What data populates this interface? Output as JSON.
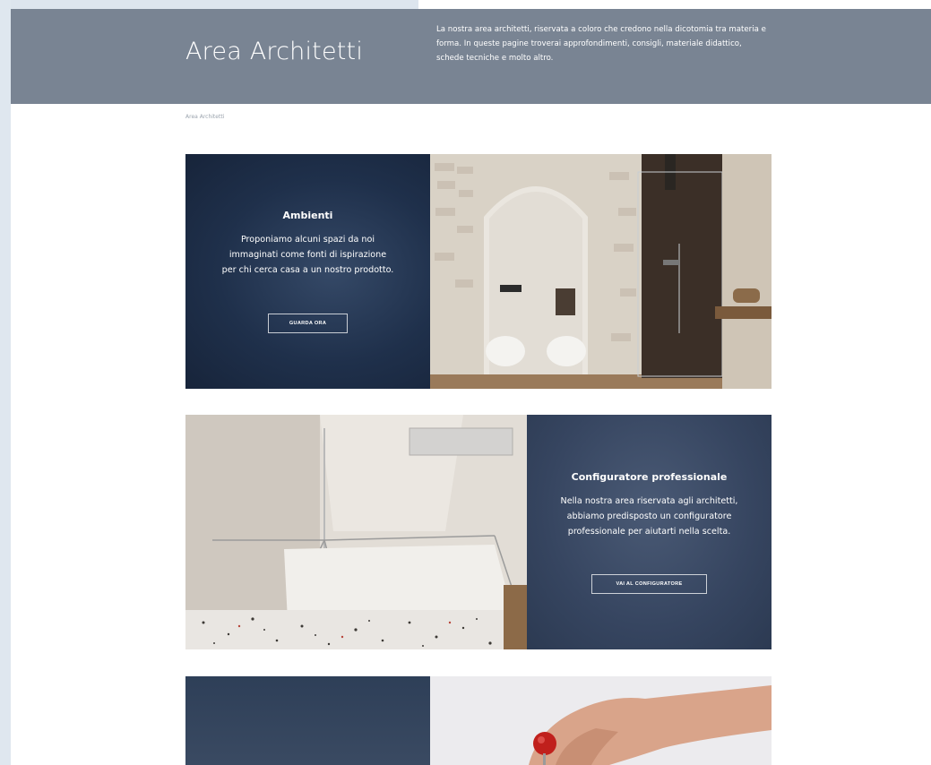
{
  "hero": {
    "title": "Area Architetti",
    "description": "La nostra area architetti, riservata a coloro che credono nella dicotomia tra materia e forma. In queste pagine troverai approfondimenti, consigli, materiale didattico, schede tecniche e molto altro."
  },
  "breadcrumb": {
    "current": "Area Architetti"
  },
  "cards": [
    {
      "title": "Ambienti",
      "text": "Proponiamo alcuni spazi da noi immaginati come fonti di ispirazione per chi cerca casa a un nostro prodotto.",
      "button": "GUARDA ORA",
      "image": "bathroom-interior-photo"
    },
    {
      "title": "Configuratore professionale",
      "text": "Nella nostra area riservata agli architetti, abbiamo predisposto un configuratore professionale per aiutarti nella scelta.",
      "button": "VAI AL CONFIGURATORE",
      "image": "shower-enclosure-photo"
    },
    {
      "image": "hand-pushpin-photo"
    }
  ],
  "colors": {
    "hero_bg": "#798493",
    "panel_dark": "#1f304b",
    "panel_slate": "#364560",
    "outer_bg": "#dfe7ef"
  }
}
